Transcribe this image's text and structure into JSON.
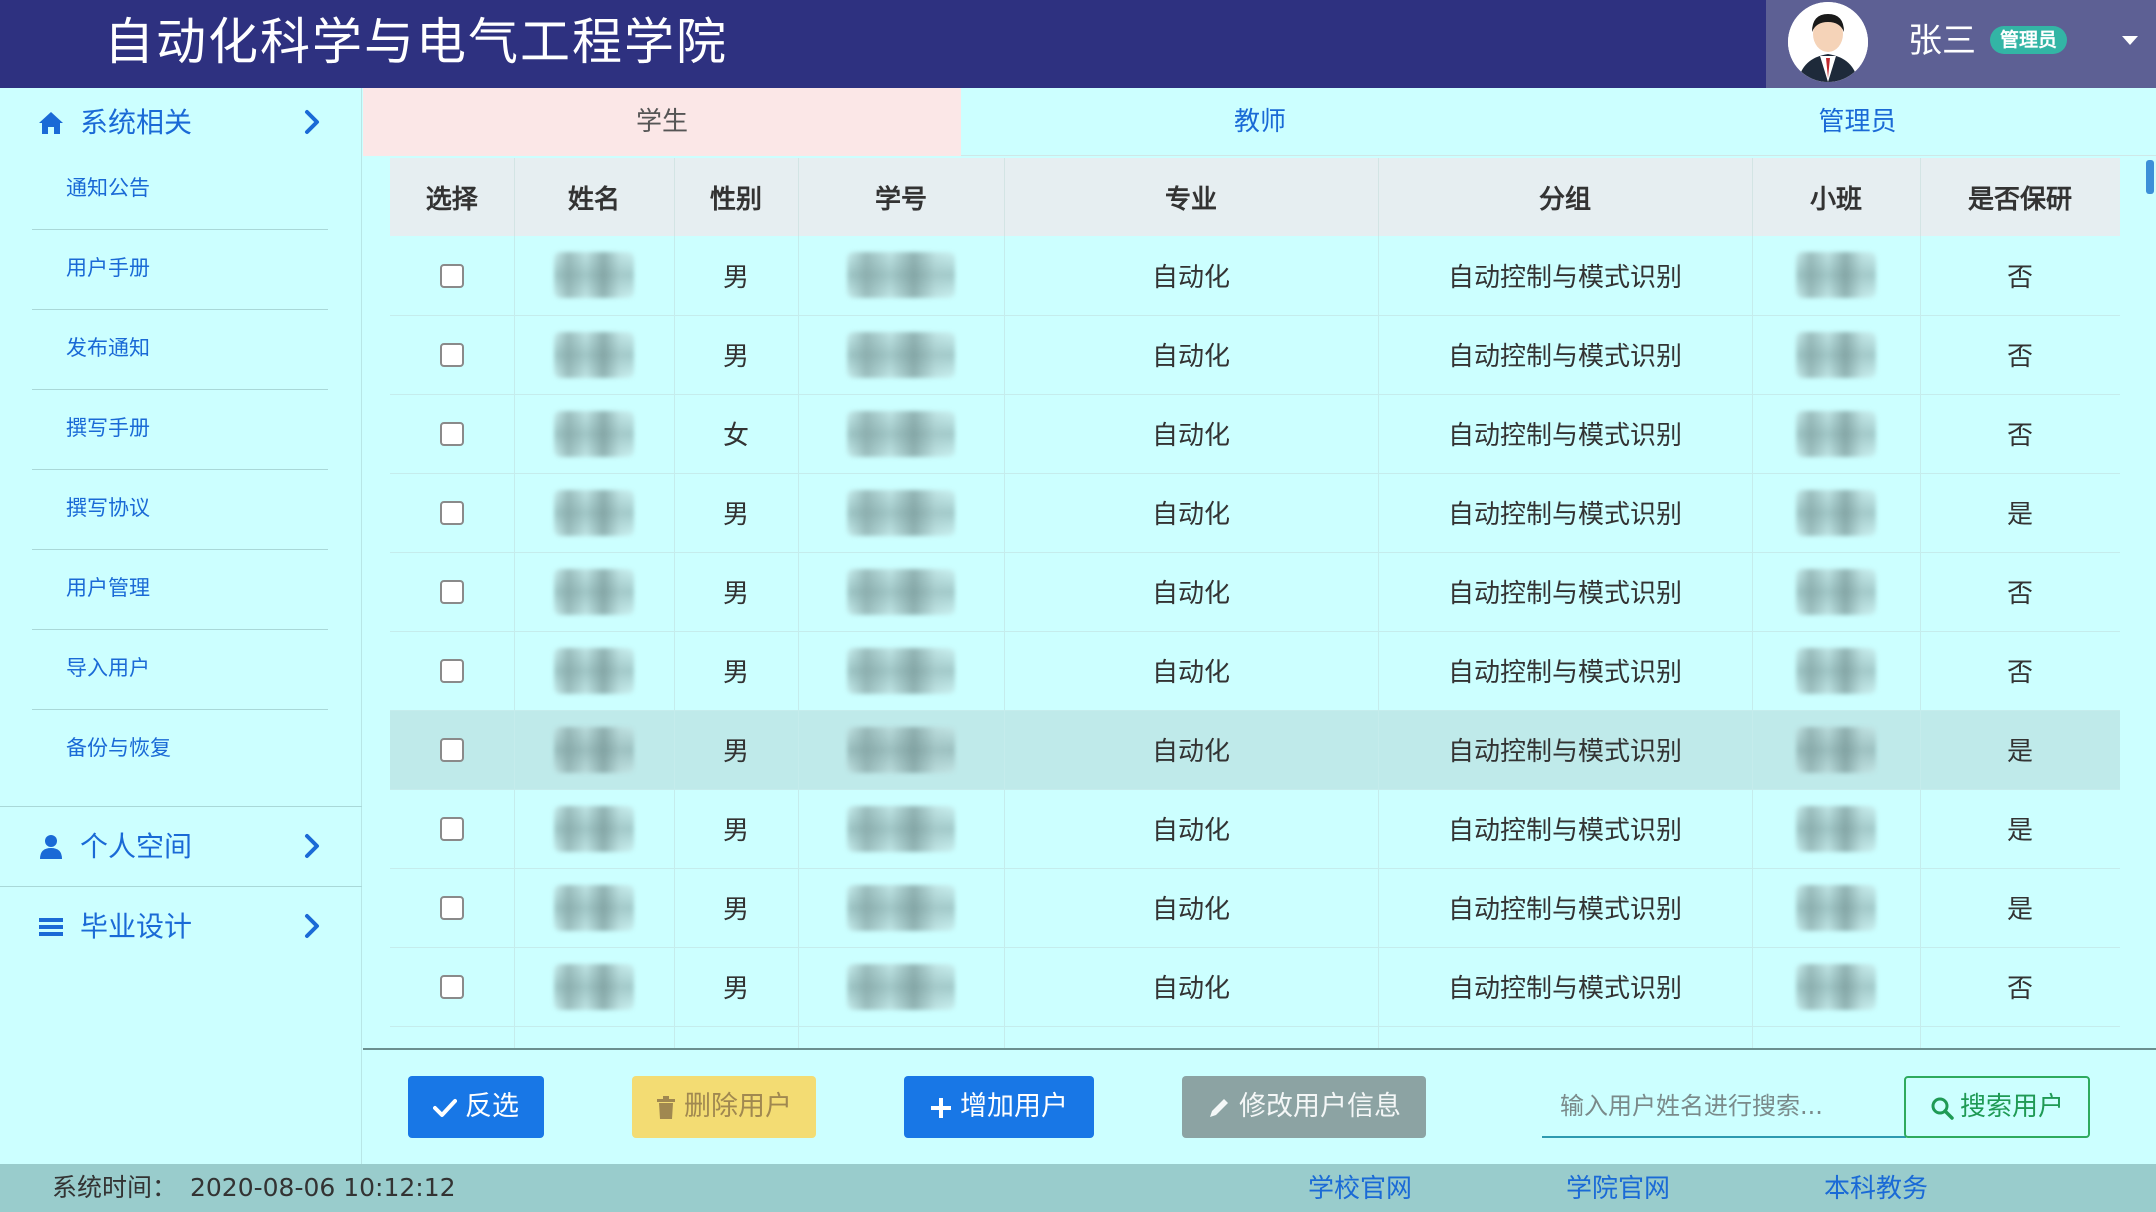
{
  "header": {
    "title": "自动化科学与电气工程学院",
    "user_name": "张三",
    "role": "管理员",
    "avatar_icon": "user-avatar-icon"
  },
  "sidebar": {
    "groups": [
      {
        "label": "系统相关",
        "icon": "home-icon"
      },
      {
        "label": "个人空间",
        "icon": "user-icon"
      },
      {
        "label": "毕业设计",
        "icon": "list-icon"
      }
    ],
    "items": [
      "通知公告",
      "用户手册",
      "发布通知",
      "撰写手册",
      "撰写协议",
      "用户管理",
      "导入用户",
      "备份与恢复"
    ]
  },
  "tabs": [
    "学生",
    "教师",
    "管理员"
  ],
  "active_tab": "学生",
  "table": {
    "columns": [
      "选择",
      "姓名",
      "性别",
      "学号",
      "专业",
      "分组",
      "小班",
      "是否保研"
    ],
    "rows": [
      {
        "gender": "男",
        "major": "自动化",
        "group": "自动控制与模式识别",
        "postgrad": "否"
      },
      {
        "gender": "男",
        "major": "自动化",
        "group": "自动控制与模式识别",
        "postgrad": "否"
      },
      {
        "gender": "女",
        "major": "自动化",
        "group": "自动控制与模式识别",
        "postgrad": "否"
      },
      {
        "gender": "男",
        "major": "自动化",
        "group": "自动控制与模式识别",
        "postgrad": "是"
      },
      {
        "gender": "男",
        "major": "自动化",
        "group": "自动控制与模式识别",
        "postgrad": "否"
      },
      {
        "gender": "男",
        "major": "自动化",
        "group": "自动控制与模式识别",
        "postgrad": "否"
      },
      {
        "gender": "男",
        "major": "自动化",
        "group": "自动控制与模式识别",
        "postgrad": "是"
      },
      {
        "gender": "男",
        "major": "自动化",
        "group": "自动控制与模式识别",
        "postgrad": "是"
      },
      {
        "gender": "男",
        "major": "自动化",
        "group": "自动控制与模式识别",
        "postgrad": "是"
      },
      {
        "gender": "男",
        "major": "自动化",
        "group": "自动控制与模式识别",
        "postgrad": "否"
      }
    ]
  },
  "actions": {
    "invert": "反选",
    "delete": "删除用户",
    "add": "增加用户",
    "edit": "修改用户信息",
    "search_placeholder": "输入用户姓名进行搜索...",
    "search": "搜索用户"
  },
  "footer": {
    "time_label": "系统时间：",
    "time_value": "2020-08-06 10:12:12",
    "links": [
      "学校官网",
      "学院官网",
      "本科教务"
    ]
  },
  "colors": {
    "header_bg": "#2e3180",
    "page_bg": "#ccffff",
    "accent_blue": "#1877e6",
    "link_blue": "#1a6ad6",
    "footer_bg": "#99cccc"
  }
}
